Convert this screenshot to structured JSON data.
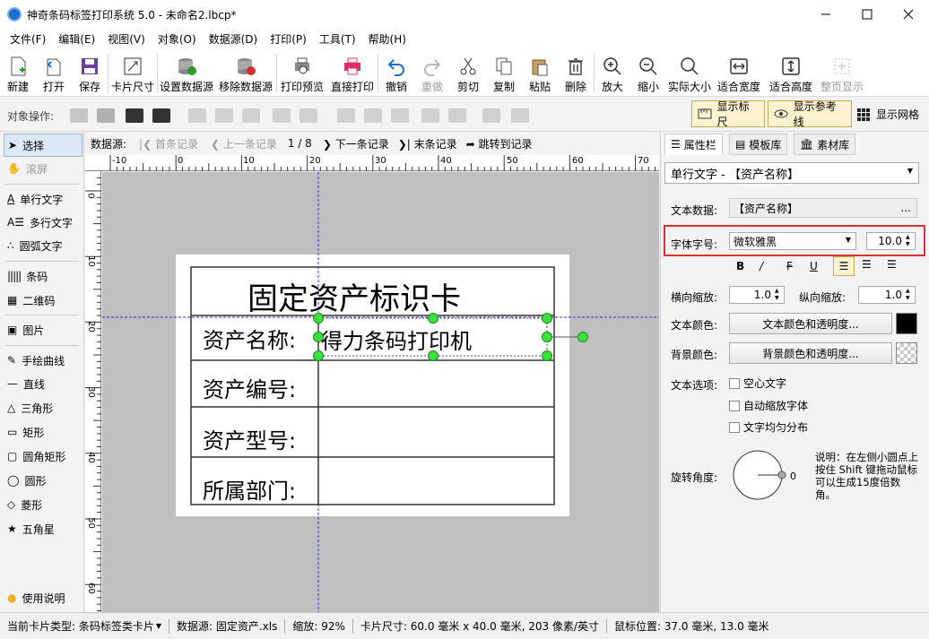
{
  "window": {
    "title": "神奇条码标签打印系统 5.0 - 未命名2.lbcp*"
  },
  "menu": [
    "文件(F)",
    "编辑(E)",
    "视图(V)",
    "对象(O)",
    "数据源(D)",
    "打印(P)",
    "工具(T)",
    "帮助(H)"
  ],
  "toolbar": {
    "new": "新建",
    "open": "打开",
    "save": "保存",
    "card_size": "卡片尺寸",
    "set_ds": "设置数据源",
    "remove_ds": "移除数据源",
    "preview": "打印预览",
    "print": "直接打印",
    "undo": "撤销",
    "redo": "重做",
    "cut": "剪切",
    "copy": "复制",
    "paste": "粘贴",
    "delete": "删除",
    "zoom_in": "放大",
    "zoom_out": "缩小",
    "actual": "实际大小",
    "fit_width": "适合宽度",
    "fit_height": "适合高度",
    "fit_page": "整页显示"
  },
  "objbar": {
    "label": "对象操作:",
    "show_ruler": "显示标尺",
    "show_guides": "显示参考线",
    "show_grid": "显示网格"
  },
  "tools": {
    "select": "选择",
    "scroll": "滚屏",
    "single_text": "单行文字",
    "multi_text": "多行文字",
    "arc_text": "圆弧文字",
    "barcode": "条码",
    "qrcode": "二维码",
    "image": "图片",
    "freehand": "手绘曲线",
    "line": "直线",
    "triangle": "三角形",
    "rect": "矩形",
    "round_rect": "圆角矩形",
    "circle": "圆形",
    "diamond": "菱形",
    "star": "五角星",
    "help": "使用说明"
  },
  "nav": {
    "ds_label": "数据源:",
    "first": "首条记录",
    "prev": "上一条记录",
    "page": "1 / 8",
    "next": "下一条记录",
    "last": "末条记录",
    "jump": "跳转到记录"
  },
  "ruler": {
    "h": [
      "-10",
      "0",
      "10",
      "20",
      "30",
      "40",
      "50",
      "60",
      "70"
    ],
    "v": [
      "0",
      "10",
      "20",
      "30",
      "40",
      "50",
      "60",
      "70"
    ]
  },
  "card": {
    "title": "固定资产标识卡",
    "label1": "资产名称:",
    "value1": "得力条码打印机",
    "label2": "资产编号:",
    "label3": "资产型号:",
    "label4": "所属部门:"
  },
  "panel": {
    "tabs": [
      "属性栏",
      "模板库",
      "素材库"
    ],
    "object_select": "单行文字 - 【资产名称】",
    "text_data_label": "文本数据:",
    "text_data": "【资产名称】",
    "more": "...",
    "font_label": "字体字号:",
    "font": "微软雅黑",
    "font_size": "10.0",
    "hscale_label": "横向缩放:",
    "hscale": "1.0",
    "vscale_label": "纵向缩放:",
    "vscale": "1.0",
    "textcolor_label": "文本颜色:",
    "textcolor_btn": "文本颜色和透明度...",
    "bgcolor_label": "背景颜色:",
    "bgcolor_btn": "背景颜色和透明度...",
    "options_label": "文本选项:",
    "opt1": "空心文字",
    "opt2": "自动缩放字体",
    "opt3": "文字均匀分布",
    "rotate_label": "旋转角度:",
    "rotate_value": "0",
    "rotate_help": "说明：在左侧小圆点上按住 Shift 键拖动鼠标可以生成15度倍数角。"
  },
  "status": {
    "card_type": "当前卡片类型: 条码标签类卡片",
    "datasource": "数据源: 固定资产.xls",
    "zoom": "缩放: 92%",
    "card_size": "卡片尺寸: 60.0 毫米 x 40.0 毫米, 203 像素/英寸",
    "mouse": "鼠标位置: 37.0 毫米, 13.0 毫米"
  },
  "colors": {
    "accent": "#1e6fd0",
    "highlight_border": "#e03030",
    "handle": "#3ce03c",
    "guide": "#3030e0"
  }
}
